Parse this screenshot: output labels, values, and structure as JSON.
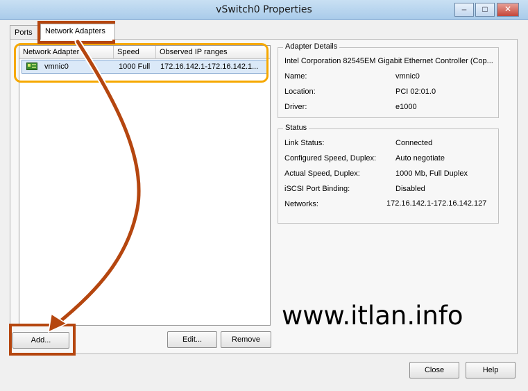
{
  "window": {
    "title": "vSwitch0 Properties",
    "minimize": "–",
    "maximize": "□",
    "close": "✕"
  },
  "tabs": [
    {
      "label": "Ports"
    },
    {
      "label": "Network Adapters"
    }
  ],
  "adapter_list": {
    "columns": [
      "Network Adapter",
      "Speed",
      "Observed IP ranges"
    ],
    "rows": [
      {
        "name": "vmnic0",
        "speed": "1000 Full",
        "ip_ranges": "172.16.142.1-172.16.142.1..."
      }
    ]
  },
  "adapter_details": {
    "label": "Adapter Details",
    "description": "Intel Corporation 82545EM Gigabit Ethernet Controller (Cop...",
    "fields": [
      {
        "key": "Name:",
        "value": "vmnic0"
      },
      {
        "key": "Location:",
        "value": "PCI 02:01.0"
      },
      {
        "key": "Driver:",
        "value": "e1000"
      }
    ]
  },
  "status": {
    "label": "Status",
    "fields": [
      {
        "key": "Link Status:",
        "value": "Connected"
      },
      {
        "key": "Configured Speed, Duplex:",
        "value": "Auto negotiate"
      },
      {
        "key": "Actual Speed, Duplex:",
        "value": "1000 Mb, Full Duplex"
      },
      {
        "key": "iSCSI Port Binding:",
        "value": "Disabled"
      },
      {
        "key": "Networks:",
        "value": "172.16.142.1-172.16.142.127"
      }
    ]
  },
  "buttons": {
    "add": "Add...",
    "edit": "Edit...",
    "remove": "Remove",
    "close": "Close",
    "help": "Help"
  },
  "watermark": "www.itlan.info",
  "colors": {
    "highlight_orange": "#f6a800",
    "annotation_brown": "#b5460f",
    "selection": "#dbe9f8"
  }
}
